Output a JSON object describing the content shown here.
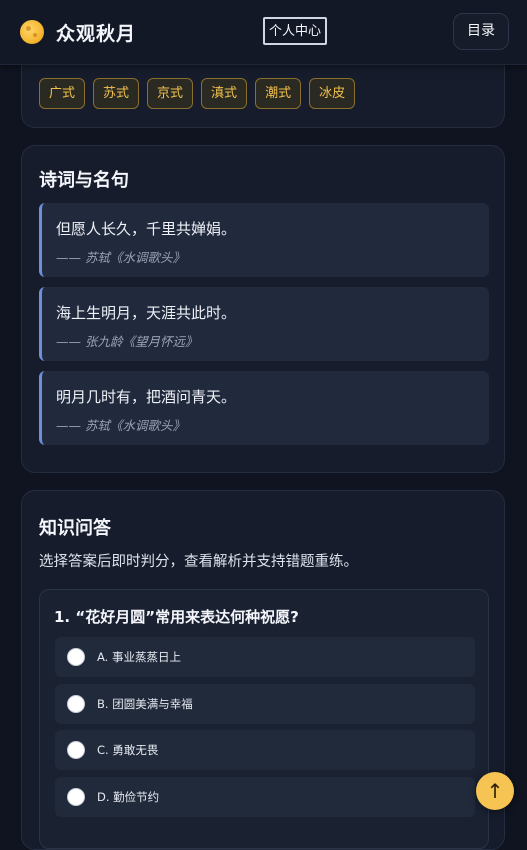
{
  "header": {
    "title": "众观秋月",
    "profile_label": "个人中心",
    "menu_label": "目录"
  },
  "tags": [
    "广式",
    "苏式",
    "京式",
    "滇式",
    "潮式",
    "冰皮"
  ],
  "poems": {
    "title": "诗词与名句",
    "items": [
      {
        "text": "但愿人长久，千里共婵娟。",
        "source": "—— 苏轼《水调歌头》"
      },
      {
        "text": "海上生明月，天涯共此时。",
        "source": "—— 张九龄《望月怀远》"
      },
      {
        "text": "明月几时有，把酒问青天。",
        "source": "—— 苏轼《水调歌头》"
      }
    ]
  },
  "quiz": {
    "title": "知识问答",
    "description": "选择答案后即时判分，查看解析并支持错题重练。",
    "question": "1. “花好月圆”常用来表达何种祝愿?",
    "options": [
      "A. 事业蒸蒸日上",
      "B. 团圆美满与幸福",
      "C. 勇敢无畏",
      "D. 勤俭节约"
    ]
  },
  "fab": {
    "icon": "arrow-up-icon",
    "glyph": "↑"
  },
  "colors": {
    "accent": "#f6c453",
    "tag_text": "#f2c14e",
    "quote_bar": "#6f8fd8"
  }
}
